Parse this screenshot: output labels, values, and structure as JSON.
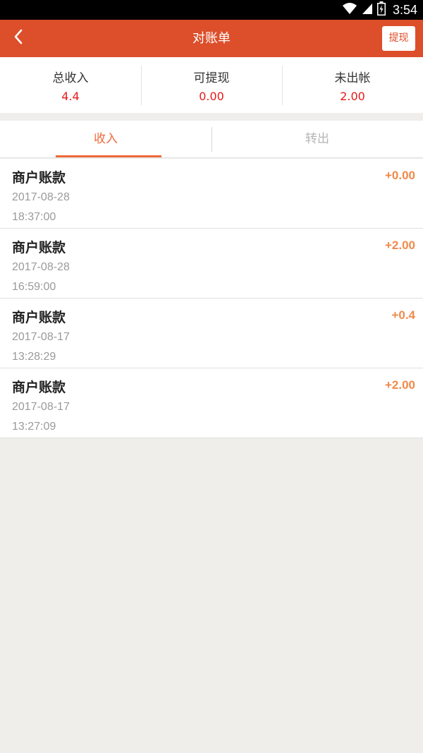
{
  "status_bar": {
    "time": "3:54"
  },
  "nav": {
    "title": "对账单",
    "withdraw_label": "提现"
  },
  "summary": [
    {
      "label": "总收入",
      "value": "4.4"
    },
    {
      "label": "可提现",
      "value": "0.00"
    },
    {
      "label": "未出帐",
      "value": "2.00"
    }
  ],
  "tabs": [
    {
      "label": "收入",
      "active": true
    },
    {
      "label": "转出",
      "active": false
    }
  ],
  "records": [
    {
      "title": "商户账款",
      "date": "2017-08-28",
      "time": "18:37:00",
      "amount": "+0.00"
    },
    {
      "title": "商户账款",
      "date": "2017-08-28",
      "time": "16:59:00",
      "amount": "+2.00"
    },
    {
      "title": "商户账款",
      "date": "2017-08-17",
      "time": "13:28:29",
      "amount": "+0.4"
    },
    {
      "title": "商户账款",
      "date": "2017-08-17",
      "time": "13:27:09",
      "amount": "+2.00"
    }
  ],
  "colors": {
    "header": "#dd4e2b",
    "accent": "#f06a3a",
    "summary_value": "#e8191a",
    "amount": "#f08a4b",
    "background": "#efeeeb"
  },
  "icons": [
    "wifi-icon",
    "signal-icon",
    "battery-icon",
    "back-arrow-icon"
  ]
}
